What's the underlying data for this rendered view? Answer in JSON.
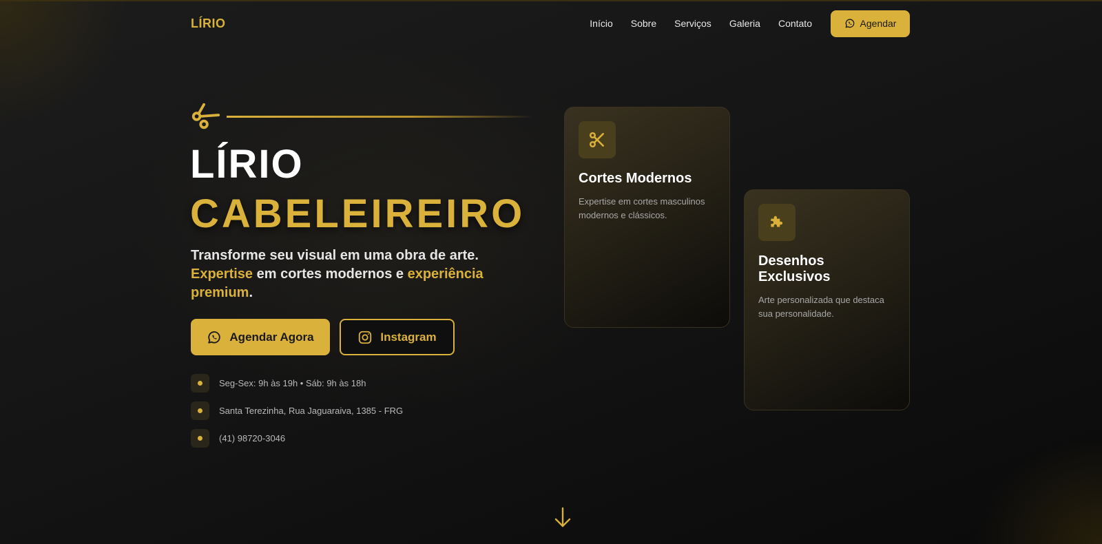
{
  "brand": {
    "logo": "LÍRIO",
    "accent": "#d9b13b"
  },
  "nav": {
    "links": [
      "Início",
      "Sobre",
      "Serviços",
      "Galeria",
      "Contato"
    ],
    "cta": {
      "label": "Agendar",
      "icon": "whatsapp-icon"
    }
  },
  "hero": {
    "title_line1": "LÍRIO",
    "title_line2": "CABELEIREIRO",
    "subtitle": {
      "part1": "Transforme seu visual em uma obra de arte. ",
      "hl1": "Expertise",
      "part2": " em cortes modernos e ",
      "hl2": "experiência premium",
      "part3": "."
    },
    "primary_button": {
      "label": "Agendar Agora",
      "icon": "whatsapp-icon"
    },
    "secondary_button": {
      "label": "Instagram",
      "icon": "instagram-icon"
    }
  },
  "info": [
    {
      "text": "Seg-Sex: 9h às 19h • Sáb: 9h às 18h"
    },
    {
      "text": "Santa Terezinha, Rua Jaguaraiva, 1385 - FRG"
    },
    {
      "text": "(41) 98720-3046"
    }
  ],
  "cards": [
    {
      "title": "Cortes Modernos",
      "desc": "Expertise em cortes masculinos modernos e clássicos.",
      "icon": "scissors-icon"
    },
    {
      "title": "Desenhos Exclusivos",
      "desc": "Arte personalizada que destaca sua personalidade.",
      "icon": "puzzle-icon"
    }
  ]
}
